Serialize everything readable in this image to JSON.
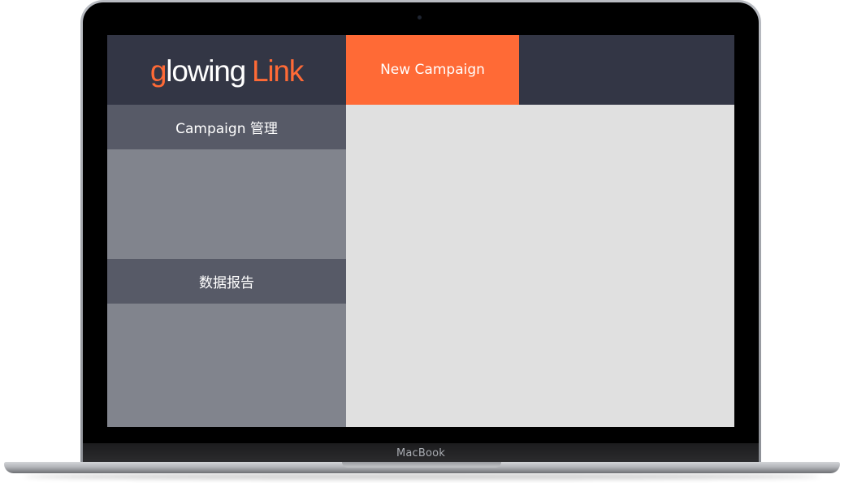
{
  "device": {
    "brand_label": "MacBook"
  },
  "app": {
    "logo": {
      "first_letter": "g",
      "word": "lowing",
      "suffix": "Link"
    },
    "colors": {
      "accent": "#ff6a36",
      "header_bg": "#333645",
      "sidebar_bg": "#81848d",
      "section_header_bg": "#575a67",
      "content_bg": "#e0e0e0"
    }
  },
  "sidebar": {
    "sections": [
      {
        "label": "Campaign 管理"
      },
      {
        "label": "数据报告"
      }
    ]
  },
  "topbar": {
    "tabs": [
      {
        "label": "New Campaign",
        "active": true
      }
    ]
  }
}
